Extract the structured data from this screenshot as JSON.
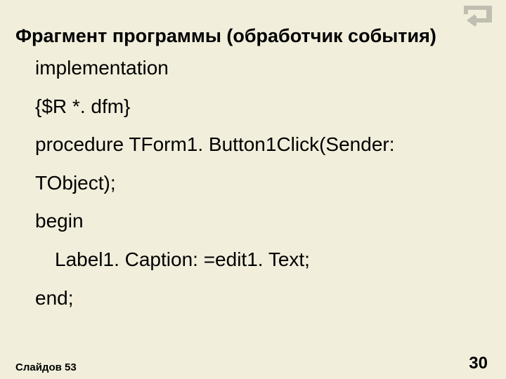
{
  "title": "Фрагмент программы (обработчик события)",
  "code": {
    "l1": "implementation",
    "l2": "{$R *. dfm}",
    "l3": "procedure TForm1. Button1Click(Sender:",
    "l4": "TObject);",
    "l5": "begin",
    "l6": "Label1. Caption: =edit1. Text;",
    "l7": "end;"
  },
  "footer": {
    "slides_label": "Слайдов 53",
    "page_number": "30"
  },
  "icons": {
    "return": "return-icon"
  }
}
